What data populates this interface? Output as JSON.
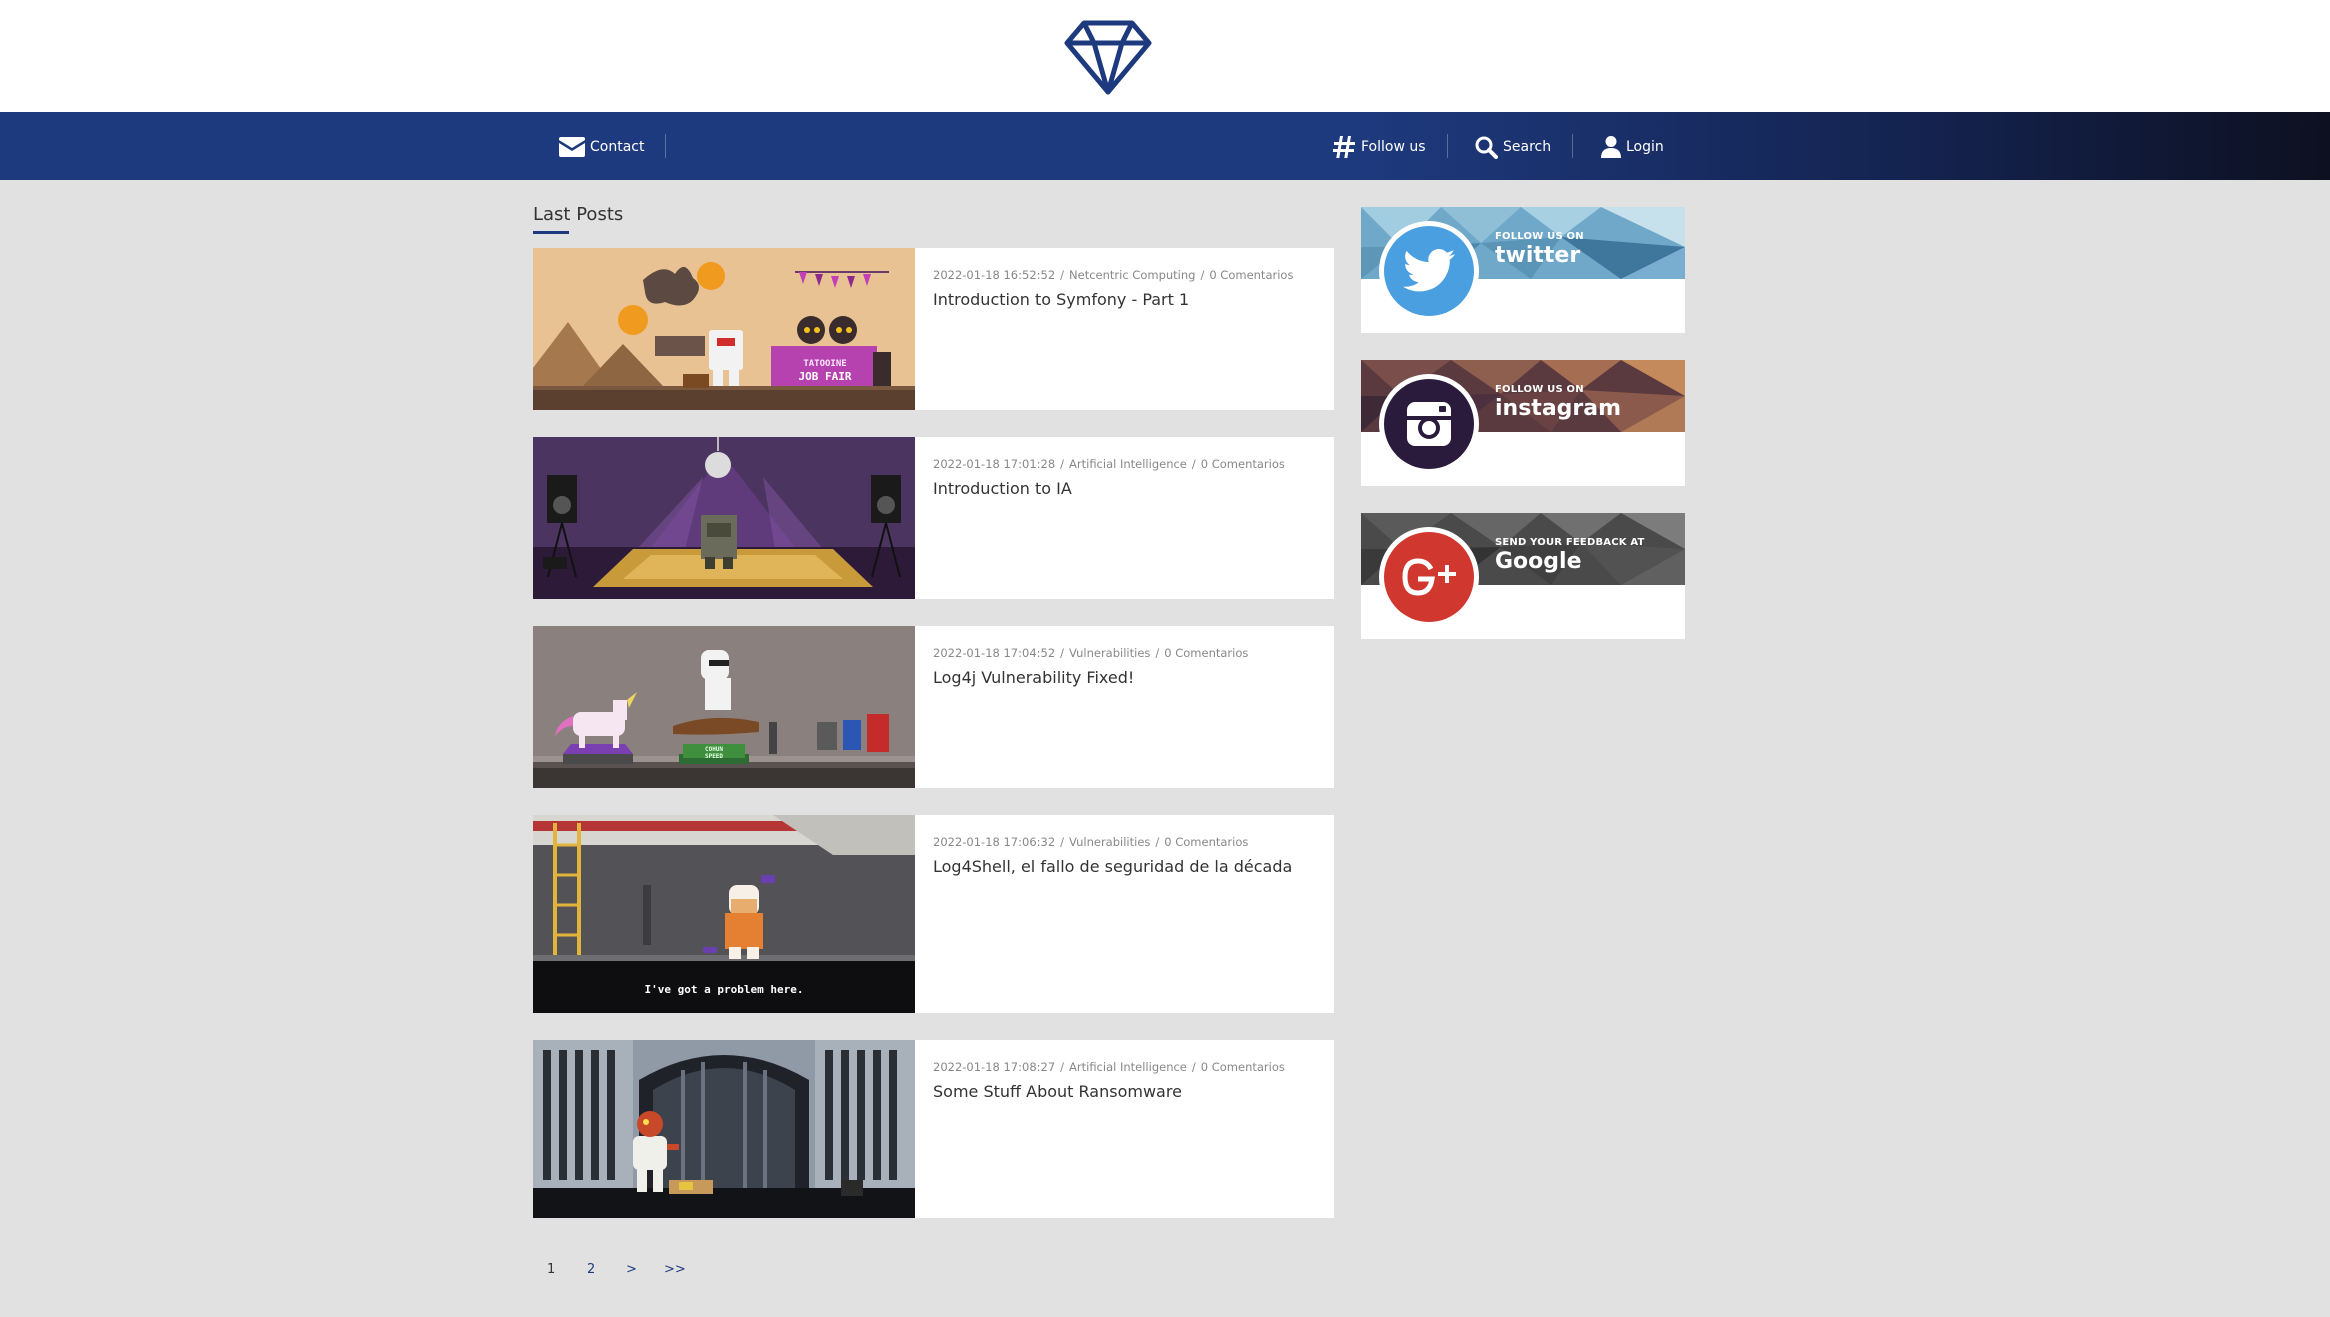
{
  "nav": {
    "contact_label": "Contact",
    "follow_label": "Follow us",
    "search_label": "Search",
    "login_label": "Login"
  },
  "section_title": "Last Posts",
  "posts": [
    {
      "date": "2022-01-18 16:52:52",
      "category": "Netcentric Computing",
      "comments": "0 Comentarios",
      "title": "Introduction to Symfony - Part 1",
      "thumb_text_1": "TATOOINE",
      "thumb_text_2": "JOB FAIR"
    },
    {
      "date": "2022-01-18 17:01:28",
      "category": "Artificial Intelligence",
      "comments": "0 Comentarios",
      "title": "Introduction to IA"
    },
    {
      "date": "2022-01-18 17:04:52",
      "category": "Vulnerabilities",
      "comments": "0 Comentarios",
      "title": "Log4j Vulnerability Fixed!",
      "thumb_text_1": "COHUN",
      "thumb_text_2": "SPEED"
    },
    {
      "date": "2022-01-18 17:06:32",
      "category": "Vulnerabilities",
      "comments": "0 Comentarios",
      "title": "Log4Shell, el fallo de seguridad de la década",
      "thumb_caption": "I've got a problem here."
    },
    {
      "date": "2022-01-18 17:08:27",
      "category": "Artificial Intelligence",
      "comments": "0 Comentarios",
      "title": "Some Stuff About Ransomware"
    }
  ],
  "widgets": [
    {
      "sub": "FOLLOW US ON",
      "name": "twitter",
      "icon": "twitter-bird-icon",
      "color": "#4a9fe0"
    },
    {
      "sub": "FOLLOW US ON",
      "name": "instagram",
      "icon": "instagram-camera-icon",
      "color": "#2a1b3d"
    },
    {
      "sub": "SEND YOUR FEEDBACK AT",
      "name": "Google",
      "icon": "google-plus-icon",
      "color": "#d0372f"
    }
  ],
  "pagination": [
    "1",
    "2",
    ">",
    ">>"
  ],
  "colors": {
    "brand": "#1e3a7e",
    "page_bg": "#e1e1e1",
    "card_bg": "#ffffff",
    "meta_text": "#888888"
  }
}
